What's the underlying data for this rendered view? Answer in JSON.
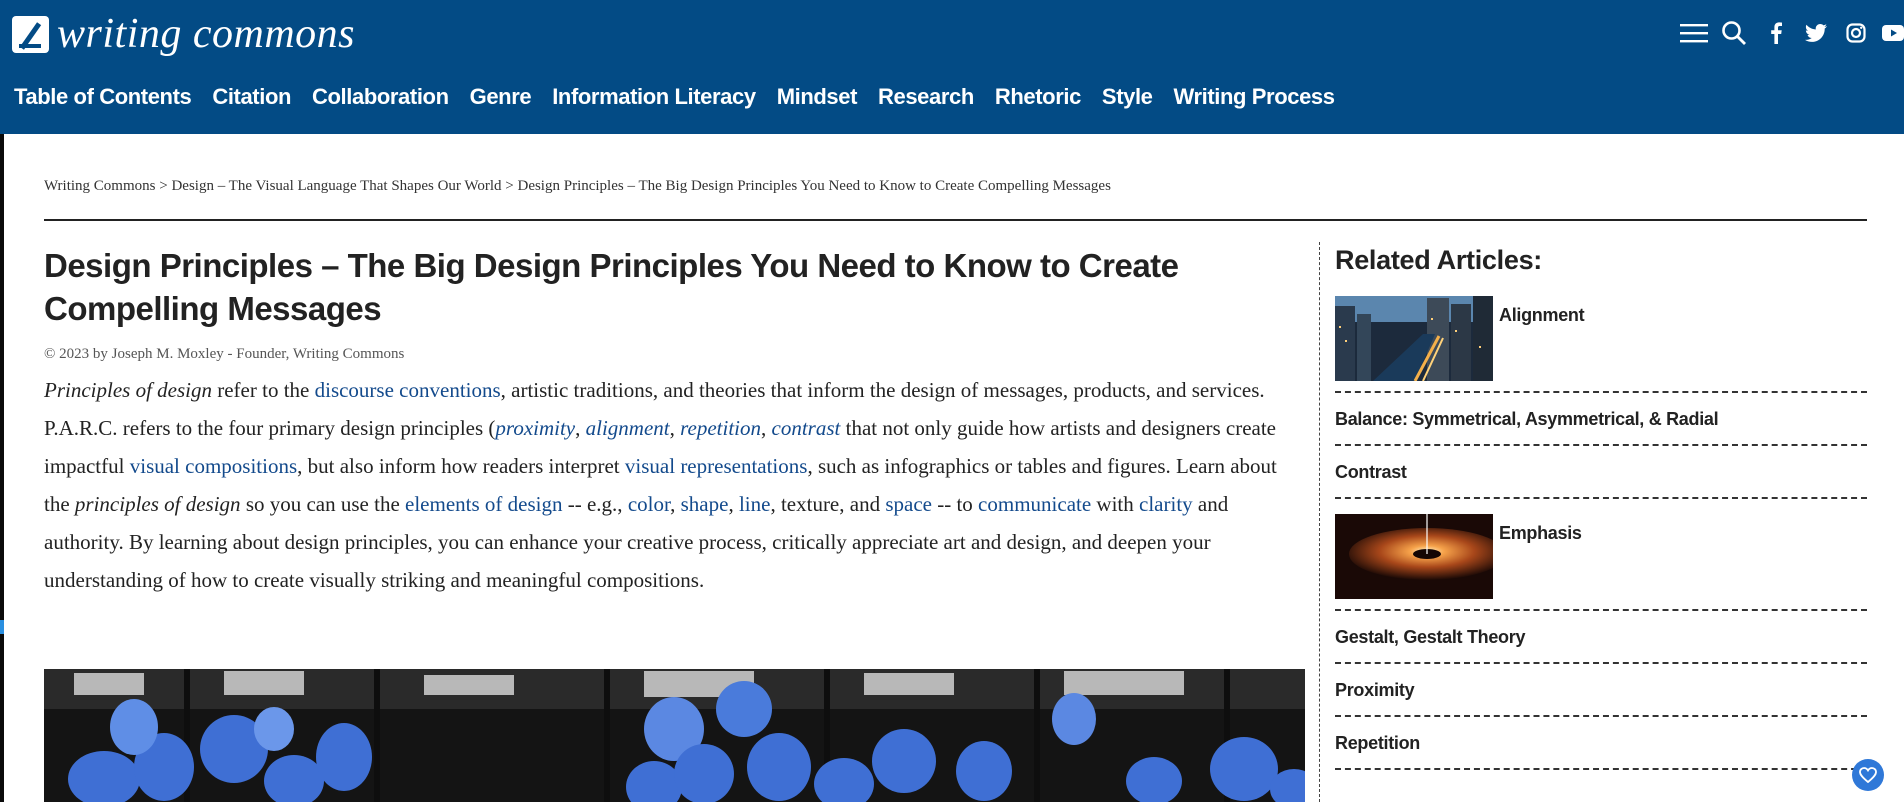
{
  "site": {
    "logo_text": "writing commons"
  },
  "header_icons": [
    "menu-icon",
    "search-icon",
    "facebook-icon",
    "twitter-icon",
    "instagram-icon",
    "youtube-icon"
  ],
  "nav": [
    "Table of Contents",
    "Citation",
    "Collaboration",
    "Genre",
    "Information Literacy",
    "Mindset",
    "Research",
    "Rhetoric",
    "Style",
    "Writing Process"
  ],
  "breadcrumb": {
    "items": [
      "Writing Commons",
      "Design – The Visual Language That Shapes Our World",
      "Design Principles – The Big Design Principles You Need to Know to Create Compelling Messages"
    ],
    "separator": ">"
  },
  "article": {
    "title": "Design Principles – The Big Design Principles You Need to Know to Create Compelling Messages",
    "byline": "© 2023 by Joseph M. Moxley - Founder, Writing Commons",
    "p": {
      "t1": "Principles of design",
      "t2": " refer to the ",
      "l1": "discourse conventions",
      "t3": ", artistic traditions, and theories that inform the design of messages, products, and services.  P.A.R.C. refers to the four primary design principles (",
      "l2": "proximity",
      "t4": ", ",
      "l3": "alignment",
      "t5": ", ",
      "l4": "repetition",
      "t6": ", ",
      "l5": "contrast",
      "t7": " that not only guide how artists and designers create impactful ",
      "l6": "visual compositions",
      "t8": ", but also inform how readers interpret ",
      "l7": "visual representations",
      "t9": ", such as infographics or tables and figures.  Learn about the ",
      "t10": "principles of design",
      "t11": " so you can use the ",
      "l8": "elements of design",
      "t12": " -- e.g.,  ",
      "l9": "color",
      "t13": ", ",
      "l10": "shape",
      "t14": ", ",
      "l11": "line",
      "t15": ", texture, and ",
      "l12": "space",
      "t16": " --  to ",
      "l13": "communicate",
      "t17": " with ",
      "l14": "clarity",
      "t18": " and authority. By learning about design principles, you can enhance your creative process, critically appreciate art and design, and deepen your understanding of how to create visually striking and meaningful compositions."
    }
  },
  "sidebar": {
    "title": "Related Articles:",
    "items": [
      {
        "label": "Alignment",
        "thumb": true
      },
      {
        "label": "Balance: Symmetrical, Asymmetrical, & Radial",
        "thumb": false
      },
      {
        "label": "Contrast",
        "thumb": false
      },
      {
        "label": "Emphasis",
        "thumb": true
      },
      {
        "label": "Gestalt, Gestalt Theory",
        "thumb": false
      },
      {
        "label": "Proximity",
        "thumb": false
      },
      {
        "label": "Repetition",
        "thumb": false
      }
    ]
  },
  "colors": {
    "header_bg": "#034b85",
    "link": "#134a8c",
    "fab": "#2f78d8"
  }
}
